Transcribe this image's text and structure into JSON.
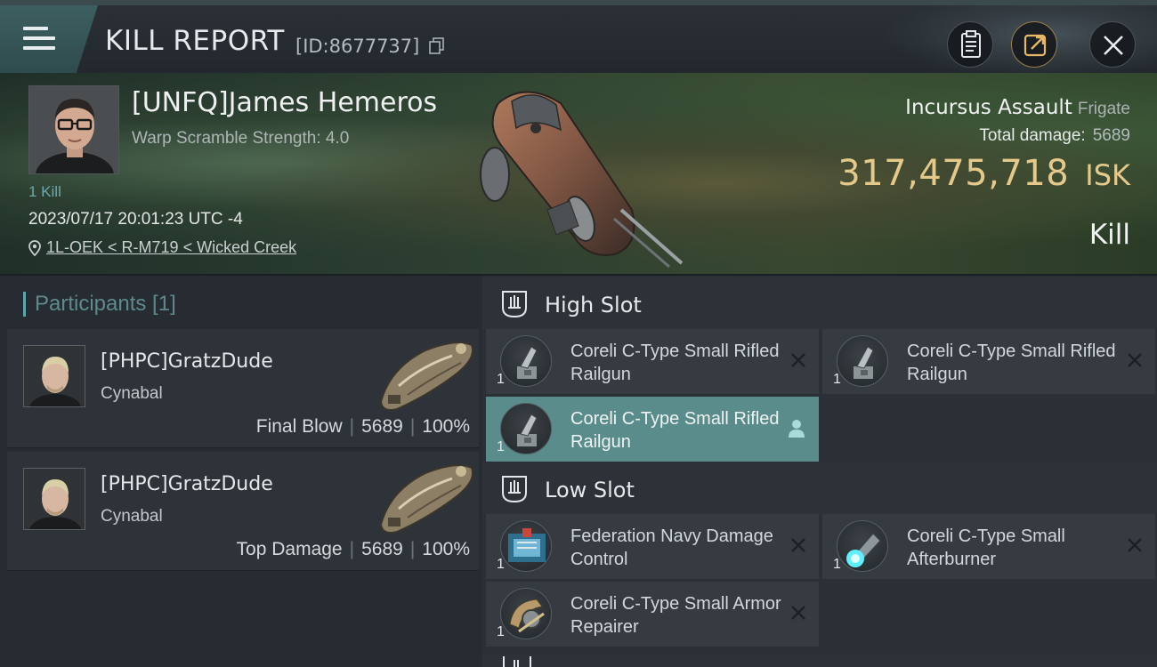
{
  "header": {
    "title": "KILL REPORT",
    "report_id": "[ID:8677737]"
  },
  "victim": {
    "name": "[UNFQ]James Hemeros",
    "subtitle": "Warp Scramble Strength: 4.0",
    "kill_count": "1 Kill",
    "datetime": "2023/07/17 20:01:23 UTC -4",
    "location": "1L-OEK < R-M719 < Wicked Creek",
    "ship_name": "Incursus Assault",
    "ship_class": "Frigate",
    "total_damage_label": "Total damage:",
    "total_damage_value": "5689",
    "isk_value": "317,475,718",
    "isk_unit": "ISK",
    "result": "Kill"
  },
  "participants": {
    "header": "Participants [1]",
    "rows": [
      {
        "name": "[PHPC]GratzDude",
        "ship": "Cynabal",
        "role": "Final Blow",
        "damage": "5689",
        "percent": "100%"
      },
      {
        "name": "[PHPC]GratzDude",
        "ship": "Cynabal",
        "role": "Top Damage",
        "damage": "5689",
        "percent": "100%"
      }
    ]
  },
  "fitting": {
    "high_slot": {
      "title": "High Slot",
      "modules": [
        {
          "qty": "1",
          "name": "Coreli C-Type Small Rifled Railgun",
          "icon": "railgun-icon"
        },
        {
          "qty": "1",
          "name": "Coreli C-Type Small Rifled Railgun",
          "icon": "railgun-icon"
        },
        {
          "qty": "1",
          "name": "Coreli C-Type Small Rifled Railgun",
          "icon": "railgun-icon"
        }
      ]
    },
    "low_slot": {
      "title": "Low Slot",
      "modules": [
        {
          "qty": "1",
          "name": "Federation Navy Damage Control",
          "icon": "damage-control-icon"
        },
        {
          "qty": "1",
          "name": "Coreli C-Type Small Afterburner",
          "icon": "afterburner-icon"
        },
        {
          "qty": "1",
          "name": "Coreli C-Type Small Armor Repairer",
          "icon": "armor-repairer-icon"
        }
      ]
    }
  },
  "colors": {
    "accent": "#5ea6ad",
    "isk_gold": "#e5c98b",
    "active_module": "#5a8c8b"
  }
}
